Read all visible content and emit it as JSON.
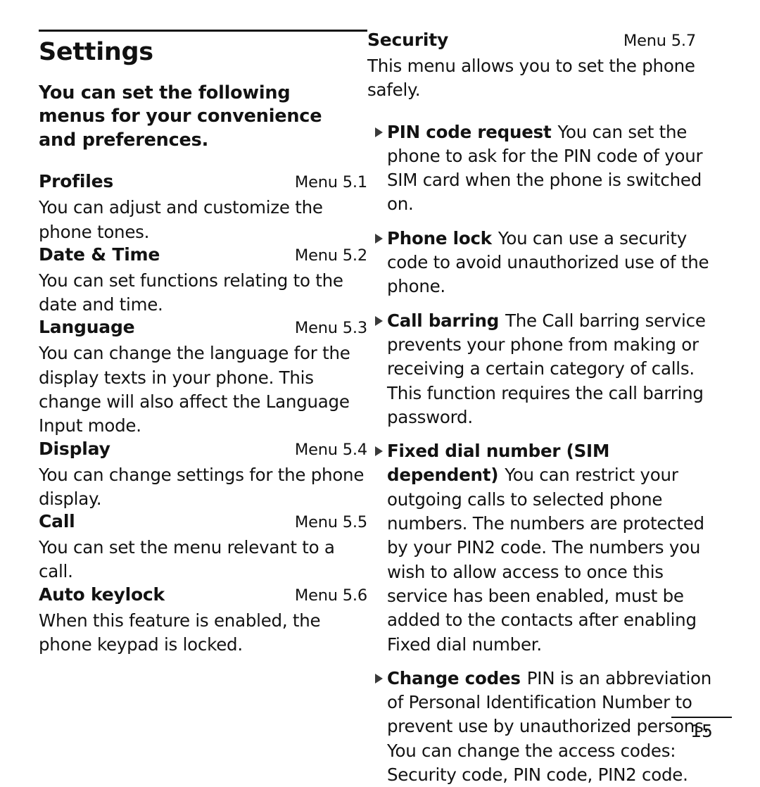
{
  "document": {
    "chapter_title": "Settings",
    "intro": "You can set the following menus for your convenience and preferences.",
    "page_number": "15"
  },
  "left_column": {
    "sections": [
      {
        "name": "Profiles",
        "menu_ref": "Menu 5.1",
        "body": "You can adjust and customize the phone tones."
      },
      {
        "name": "Date & Time",
        "menu_ref": "Menu 5.2",
        "body": "You can set functions relating to the date and time."
      },
      {
        "name": "Language",
        "menu_ref": "Menu 5.3",
        "body": "You can change the language for the display texts in your phone. This change will also affect the Language Input mode."
      },
      {
        "name": "Display",
        "menu_ref": "Menu 5.4",
        "body": "You can change settings for the phone display."
      },
      {
        "name": "Call",
        "menu_ref": "Menu 5.5",
        "body": "You can set the menu relevant to a call."
      },
      {
        "name": "Auto keylock",
        "menu_ref": "Menu 5.6",
        "body": "When this feature is enabled, the phone keypad is locked."
      }
    ]
  },
  "right_column": {
    "section": {
      "name": "Security",
      "menu_ref": "Menu 5.7",
      "body": "This menu allows you to set the phone safely."
    },
    "bullets": [
      {
        "term": "PIN code request",
        "description": "You can set the phone to ask for the PIN code of your SIM card when the phone is switched on."
      },
      {
        "term": "Phone lock",
        "description": "You can use a security code to avoid unauthorized use of the phone."
      },
      {
        "term": "Call barring",
        "description": "The Call barring service prevents your phone from making or receiving a certain category of calls. This function requires the call barring password."
      },
      {
        "term": "Fixed dial number (SIM dependent)",
        "description": "You can restrict your outgoing calls to selected phone numbers. The numbers are protected by your PIN2 code. The numbers you wish to allow access to once this service has been enabled, must be added to the contacts after enabling Fixed dial number."
      },
      {
        "term": "Change codes",
        "description": "PIN is an abbreviation of Personal Identification Number to prevent use by unauthorized persons. You can change the access codes: Security code, PIN code, PIN2 code."
      }
    ]
  }
}
